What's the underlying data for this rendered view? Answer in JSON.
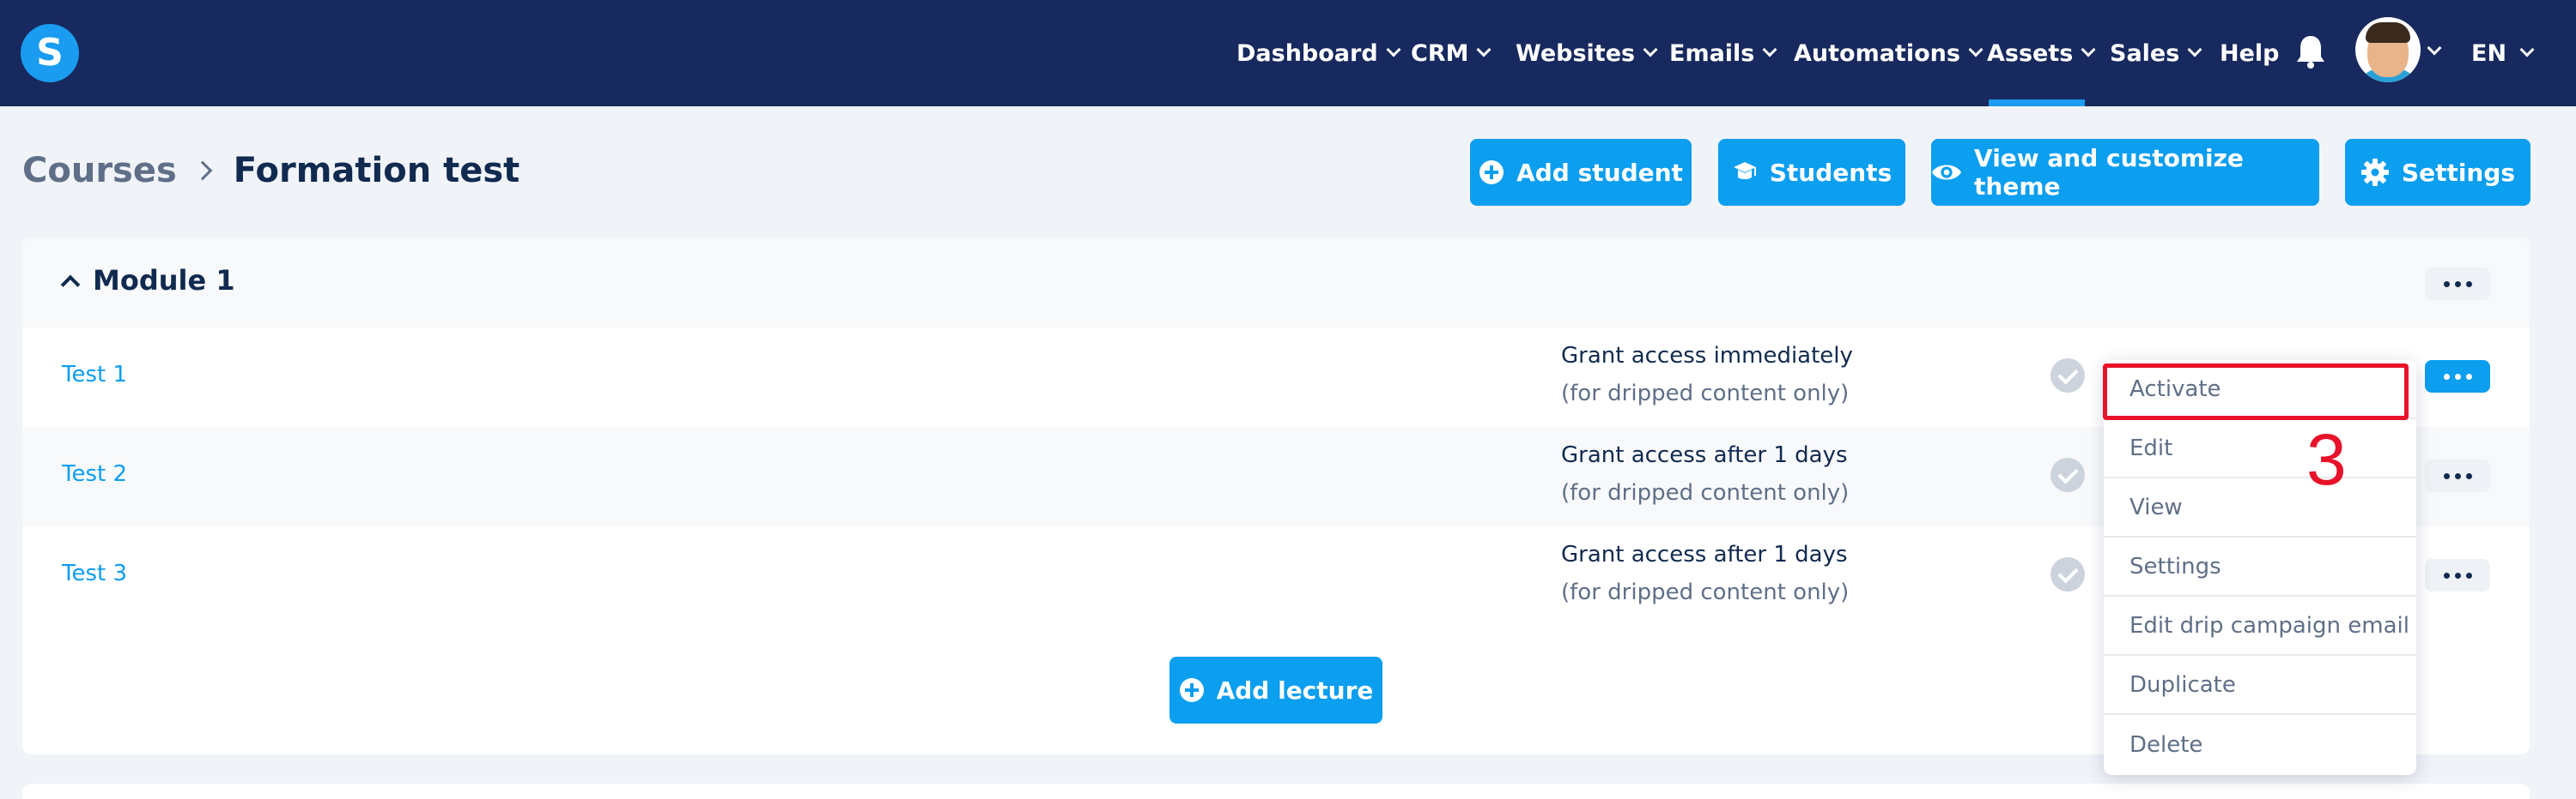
{
  "nav": {
    "logo_letter": "S",
    "items": [
      {
        "label": "Dashboard"
      },
      {
        "label": "CRM"
      },
      {
        "label": "Websites"
      },
      {
        "label": "Emails"
      },
      {
        "label": "Automations"
      },
      {
        "label": "Assets"
      },
      {
        "label": "Sales"
      },
      {
        "label": "Help"
      }
    ],
    "active_item": "Assets",
    "language": "EN"
  },
  "breadcrumb": {
    "parent": "Courses",
    "current": "Formation test"
  },
  "toolbar": {
    "add_student": "Add student",
    "students": "Students",
    "view_theme": "View and customize theme",
    "settings": "Settings"
  },
  "module": {
    "title": "Module 1",
    "lectures": [
      {
        "title": "Test 1",
        "access": "Grant access immediately",
        "note": "(for dripped content only)"
      },
      {
        "title": "Test 2",
        "access": "Grant access after 1 days",
        "note": "(for dripped content only)"
      },
      {
        "title": "Test 3",
        "access": "Grant access after 1 days",
        "note": "(for dripped content only)"
      }
    ],
    "add_lecture": "Add lecture"
  },
  "dropdown": {
    "items": [
      "Activate",
      "Edit",
      "View",
      "Settings",
      "Edit drip campaign email",
      "Duplicate",
      "Delete"
    ]
  },
  "annotation": {
    "step": "3"
  },
  "colors": {
    "nav_bg": "#17295e",
    "accent": "#0c9eef",
    "highlight": "#e8132a"
  }
}
